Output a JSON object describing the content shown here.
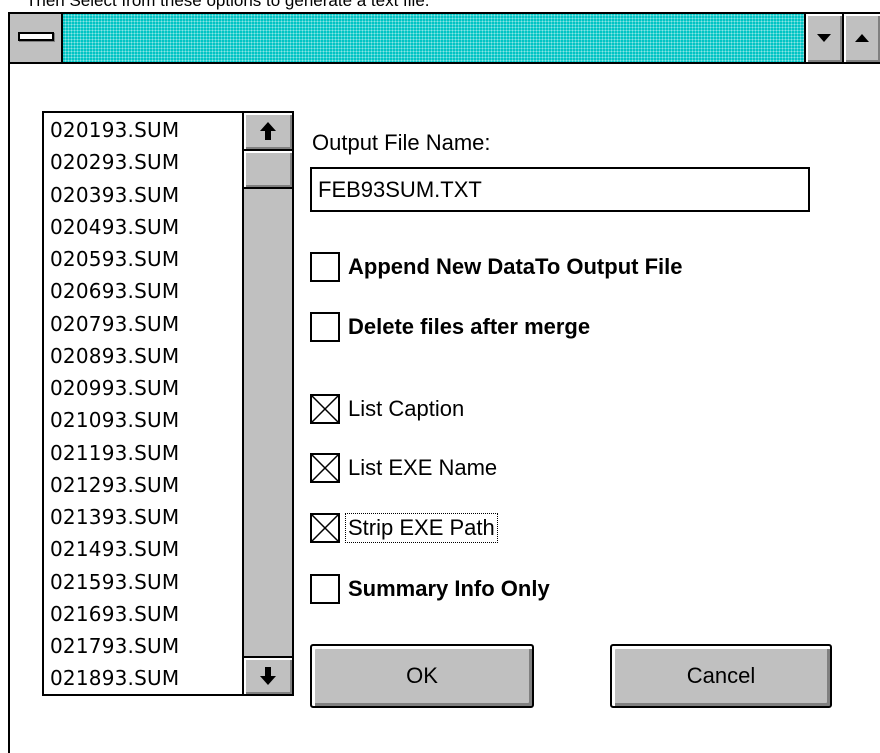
{
  "document": {
    "intro_text": "Then Select from these options to generate a text file."
  },
  "window": {
    "titlebar_color": "#00c4c4",
    "system_menu_icon": "system-menu-icon",
    "minimize_icon": "minimize-icon",
    "maximize_icon": "maximize-icon"
  },
  "file_list": {
    "items": [
      "020193.SUM",
      "020293.SUM",
      "020393.SUM",
      "020493.SUM",
      "020593.SUM",
      "020693.SUM",
      "020793.SUM",
      "020893.SUM",
      "020993.SUM",
      "021093.SUM",
      "021193.SUM",
      "021293.SUM",
      "021393.SUM",
      "021493.SUM",
      "021593.SUM",
      "021693.SUM",
      "021793.SUM",
      "021893.SUM"
    ],
    "scroll_up_icon": "arrow-up-icon",
    "scroll_down_icon": "arrow-down-icon",
    "scroll_up_glyph": "🡅",
    "scroll_down_glyph": "🡇"
  },
  "output": {
    "label": "Output File Name:",
    "value": "FEB93SUM.TXT"
  },
  "options": {
    "append": {
      "label": "Append New DataTo Output File",
      "checked": false
    },
    "delete_after_merge": {
      "label": "Delete files after merge",
      "checked": false
    },
    "list_caption": {
      "label": "List Caption",
      "checked": true
    },
    "list_exe_name": {
      "label": "List EXE Name",
      "checked": true
    },
    "strip_exe_path": {
      "label": "Strip EXE Path",
      "checked": true
    },
    "summary_info_only": {
      "label": "Summary Info Only",
      "checked": false
    }
  },
  "buttons": {
    "ok_label": "OK",
    "cancel_label": "Cancel"
  }
}
